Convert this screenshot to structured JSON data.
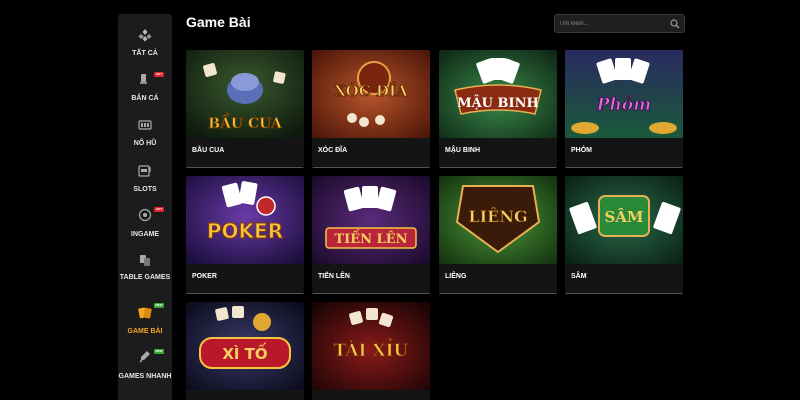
{
  "header": {
    "title": "Game Bài"
  },
  "search": {
    "placeholder": "Tìm kiếm..."
  },
  "sidebar": {
    "items": [
      {
        "label": "TẤT CẢ",
        "icon": "all-games-icon",
        "badge": null
      },
      {
        "label": "BẮN CÁ",
        "icon": "fish-shooting-icon",
        "badge": "HOT"
      },
      {
        "label": "NỔ HŨ",
        "icon": "jackpot-icon",
        "badge": null
      },
      {
        "label": "SLOTS",
        "icon": "slots-icon",
        "badge": null
      },
      {
        "label": "INGAME",
        "icon": "ingame-icon",
        "badge": "HOT"
      },
      {
        "label": "TABLE GAMES",
        "icon": "table-games-icon",
        "badge": null
      },
      {
        "label": "GAME BÀI",
        "icon": "card-games-icon",
        "badge": "NEW",
        "active": true
      },
      {
        "label": "GAMES NHANH",
        "icon": "quick-games-icon",
        "badge": "NEW"
      }
    ]
  },
  "games": [
    {
      "name": "BẦU CUA",
      "art_text": "BẦU CUA"
    },
    {
      "name": "XÓC ĐĨA",
      "art_text": "XÓC ĐĨA"
    },
    {
      "name": "MẬU BINH",
      "art_text": "MẬU BINH"
    },
    {
      "name": "PHỎM",
      "art_text": "Phỏm"
    },
    {
      "name": "POKER",
      "art_text": "POKER"
    },
    {
      "name": "TIẾN LÊN",
      "art_text": "TIẾN LÊN"
    },
    {
      "name": "LIÊNG",
      "art_text": "LIÊNG"
    },
    {
      "name": "SÂM",
      "art_text": "SÂM"
    },
    {
      "name": "",
      "art_text": "XÌ TỐ"
    },
    {
      "name": "",
      "art_text": "TÀI XỈU"
    }
  ],
  "colors": {
    "accent": "#f5a623",
    "hot": "#e0242b",
    "new": "#3aa635",
    "sidebar_bg": "#1c1c1c",
    "page_bg": "#000000"
  }
}
